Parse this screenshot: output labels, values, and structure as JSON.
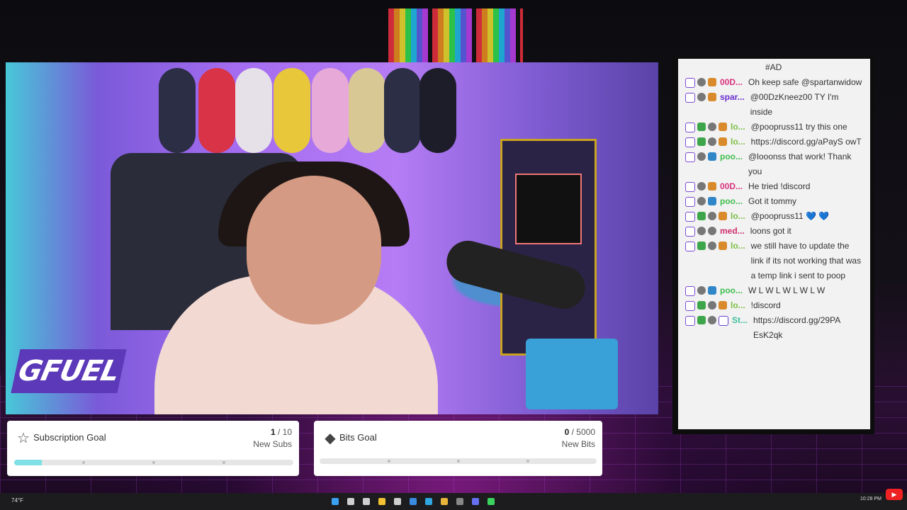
{
  "colors": {
    "chat_bg": "#f2f2f2",
    "goal_bg": "#ffffff",
    "progress_fill": "#7fe0e6",
    "taskbar_bg": "#1c1c1e"
  },
  "brand": {
    "logo_text": "GFUEL"
  },
  "chat": {
    "messages": [
      {
        "badges": [],
        "user": "",
        "user_color": "#555",
        "text": "#AD"
      },
      {
        "badges": [
          "twitch-badge",
          "gray-badge",
          "orange-badge"
        ],
        "user": "00D...",
        "user_color": "#d8327e",
        "text": "Oh keep safe @spartanwidow"
      },
      {
        "badges": [
          "twitch-badge",
          "gray-badge",
          "orange-badge"
        ],
        "user": "spar...",
        "user_color": "#6a2fcf",
        "text": "@00DzKneez00 TY I'm inside"
      },
      {
        "badges": [
          "twitch-badge",
          "mod-badge",
          "gray-badge",
          "orange-badge"
        ],
        "user": "lo...",
        "user_color": "#7bbf45",
        "text": "@poopruss11 try this one"
      },
      {
        "badges": [
          "twitch-badge",
          "mod-badge",
          "gray-badge",
          "orange-badge"
        ],
        "user": "lo...",
        "user_color": "#7bbf45",
        "text": "https://discord.gg/aPayS owT"
      },
      {
        "badges": [
          "twitch-badge",
          "gray-badge",
          "blue-badge"
        ],
        "user": "poo...",
        "user_color": "#3fbf4e",
        "text": "@looonss that work! Thank you"
      },
      {
        "badges": [
          "twitch-badge",
          "gray-badge",
          "orange-badge"
        ],
        "user": "00D...",
        "user_color": "#d8327e",
        "text": "He tried !discord"
      },
      {
        "badges": [
          "twitch-badge",
          "gray-badge",
          "blue-badge"
        ],
        "user": "poo...",
        "user_color": "#3fbf4e",
        "text": "Got it tommy"
      },
      {
        "badges": [
          "twitch-badge",
          "mod-badge",
          "gray-badge",
          "orange-badge"
        ],
        "user": "lo...",
        "user_color": "#7bbf45",
        "text": "@poopruss11 💙 💙"
      },
      {
        "badges": [
          "twitch-badge",
          "gray-badge",
          "gray-badge"
        ],
        "user": "med...",
        "user_color": "#cf2f6f",
        "text": "loons got it"
      },
      {
        "badges": [
          "twitch-badge",
          "mod-badge",
          "gray-badge",
          "orange-badge"
        ],
        "user": "lo...",
        "user_color": "#7bbf45",
        "text": "we still have to update the link if its not working that was a temp link i sent to poop"
      },
      {
        "badges": [
          "twitch-badge",
          "gray-badge",
          "blue-badge"
        ],
        "user": "poo...",
        "user_color": "#3fbf4e",
        "text": "W L W L W L W L W"
      },
      {
        "badges": [
          "twitch-badge",
          "mod-badge",
          "gray-badge",
          "orange-badge"
        ],
        "user": "lo...",
        "user_color": "#7bbf45",
        "text": "!discord"
      },
      {
        "badges": [
          "twitch-badge",
          "mod-badge",
          "gray-badge",
          "purple-badge"
        ],
        "user": "St...",
        "user_color": "#3fbf9e",
        "text": "https://discord.gg/29PA EsK2qk"
      }
    ]
  },
  "goals": {
    "subs": {
      "title": "Subscription Goal",
      "current": "1",
      "sep": " / ",
      "target": "10",
      "unit": "New Subs",
      "progress": 0.1,
      "icon": "star-badge-icon"
    },
    "bits": {
      "title": "Bits Goal",
      "current": "0",
      "sep": " / ",
      "target": "5000",
      "unit": "New Bits",
      "progress": 0.0,
      "icon": "bits-gem-icon"
    }
  },
  "taskbar": {
    "weather": "74°F",
    "time": "10:28 PM",
    "date": "",
    "pinned_icons": [
      "windows-start-icon",
      "search-icon",
      "task-view-icon",
      "file-explorer-icon",
      "store-icon",
      "mail-icon",
      "browser-icon",
      "chrome-icon",
      "obs-icon",
      "discord-icon",
      "spotify-icon"
    ]
  }
}
